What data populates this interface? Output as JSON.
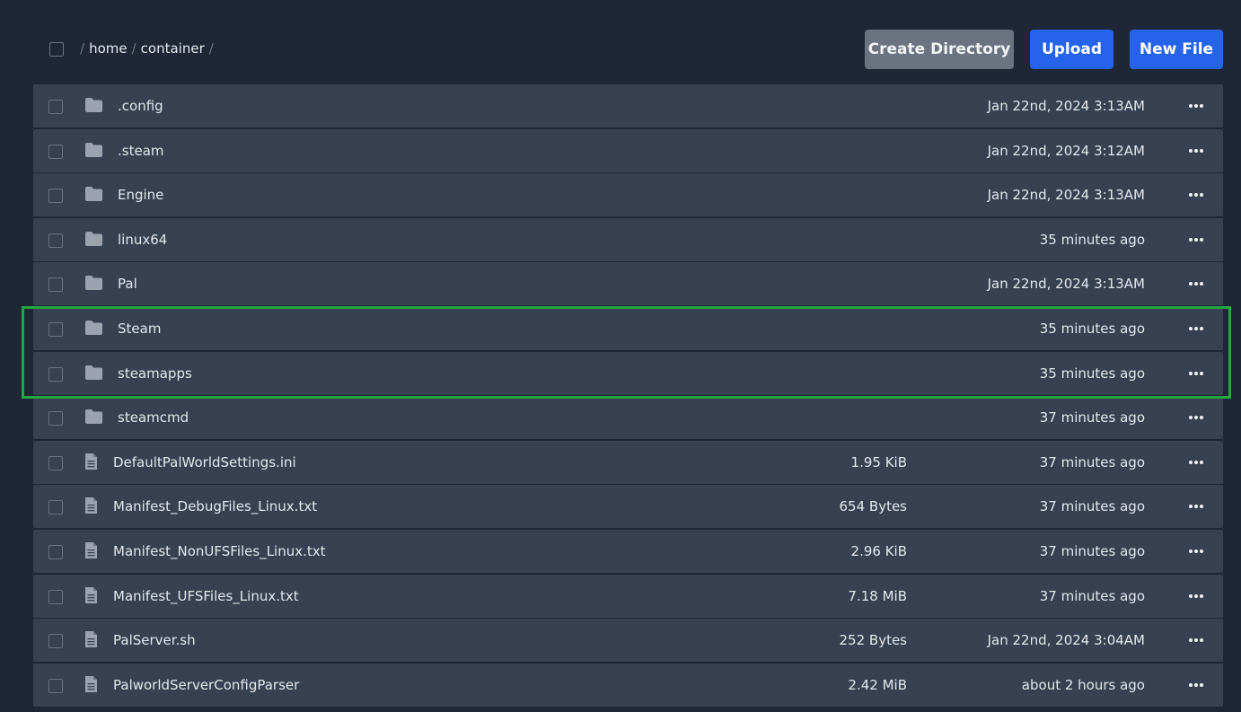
{
  "breadcrumb": {
    "separator": "/",
    "parts": [
      "home",
      "container"
    ]
  },
  "actions": {
    "create_directory": "Create Directory",
    "upload": "Upload",
    "new_file": "New File"
  },
  "colors": {
    "background": "#1f2736",
    "row": "#374151",
    "primary_button": "#2563eb",
    "secondary_button": "#6b7280",
    "highlight": "#22a83e"
  },
  "files": [
    {
      "type": "folder",
      "icon": "folder-icon",
      "name": ".config",
      "size": "",
      "modified": "Jan 22nd, 2024 3:13AM"
    },
    {
      "type": "folder",
      "icon": "folder-icon",
      "name": ".steam",
      "size": "",
      "modified": "Jan 22nd, 2024 3:12AM"
    },
    {
      "type": "folder",
      "icon": "folder-icon",
      "name": "Engine",
      "size": "",
      "modified": "Jan 22nd, 2024 3:13AM"
    },
    {
      "type": "folder",
      "icon": "folder-icon",
      "name": "linux64",
      "size": "",
      "modified": "35 minutes ago"
    },
    {
      "type": "folder",
      "icon": "folder-icon",
      "name": "Pal",
      "size": "",
      "modified": "Jan 22nd, 2024 3:13AM"
    },
    {
      "type": "folder",
      "icon": "folder-icon",
      "name": "Steam",
      "size": "",
      "modified": "35 minutes ago"
    },
    {
      "type": "folder",
      "icon": "folder-icon",
      "name": "steamapps",
      "size": "",
      "modified": "35 minutes ago"
    },
    {
      "type": "folder",
      "icon": "folder-icon",
      "name": "steamcmd",
      "size": "",
      "modified": "37 minutes ago"
    },
    {
      "type": "file",
      "icon": "file-icon",
      "name": "DefaultPalWorldSettings.ini",
      "size": "1.95 KiB",
      "modified": "37 minutes ago"
    },
    {
      "type": "file",
      "icon": "file-icon",
      "name": "Manifest_DebugFiles_Linux.txt",
      "size": "654 Bytes",
      "modified": "37 minutes ago"
    },
    {
      "type": "file",
      "icon": "file-icon",
      "name": "Manifest_NonUFSFiles_Linux.txt",
      "size": "2.96 KiB",
      "modified": "37 minutes ago"
    },
    {
      "type": "file",
      "icon": "file-icon",
      "name": "Manifest_UFSFiles_Linux.txt",
      "size": "7.18 MiB",
      "modified": "37 minutes ago"
    },
    {
      "type": "file",
      "icon": "file-icon",
      "name": "PalServer.sh",
      "size": "252 Bytes",
      "modified": "Jan 22nd, 2024 3:04AM"
    },
    {
      "type": "file",
      "icon": "file-icon",
      "name": "PalworldServerConfigParser",
      "size": "2.42 MiB",
      "modified": "about 2 hours ago"
    }
  ]
}
